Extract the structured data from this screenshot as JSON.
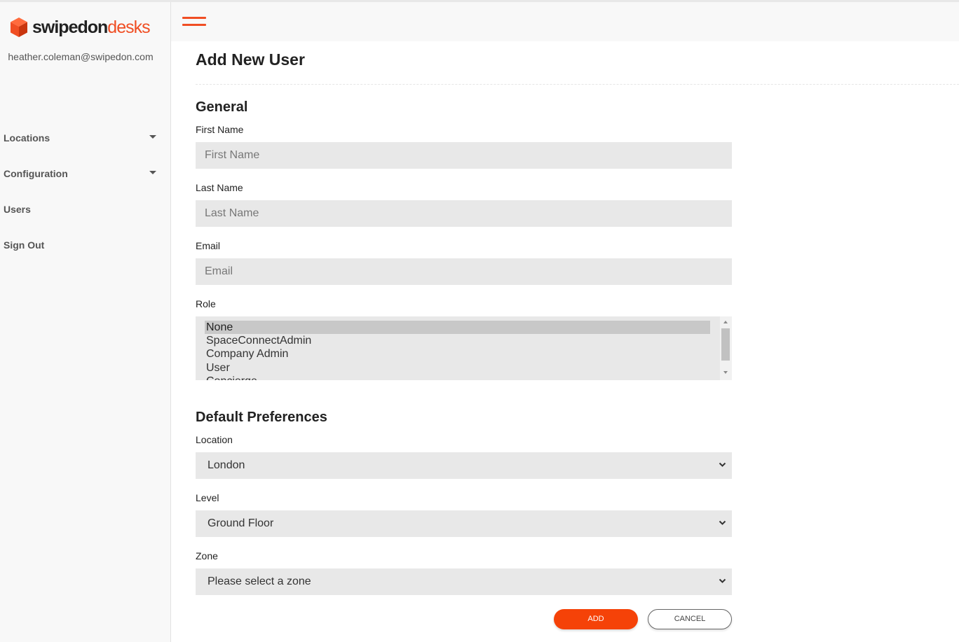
{
  "brand": {
    "name_part1": "swipedon",
    "name_part2": "desks",
    "accent_color": "#f04e23",
    "logo_icon": "cube-logo-icon"
  },
  "sidebar": {
    "user_email": "heather.coleman@swipedon.com",
    "items": [
      {
        "label": "Locations",
        "has_caret": true
      },
      {
        "label": "Configuration",
        "has_caret": true
      },
      {
        "label": "Users",
        "has_caret": false
      },
      {
        "label": "Sign Out",
        "has_caret": false
      }
    ]
  },
  "header": {
    "menu_icon": "hamburger-menu-icon"
  },
  "page": {
    "title": "Add New User"
  },
  "general": {
    "title": "General",
    "first_name": {
      "label": "First Name",
      "placeholder": "First Name",
      "value": ""
    },
    "last_name": {
      "label": "Last Name",
      "placeholder": "Last Name",
      "value": ""
    },
    "email": {
      "label": "Email",
      "placeholder": "Email",
      "value": ""
    },
    "role": {
      "label": "Role",
      "options": [
        "None",
        "SpaceConnectAdmin",
        "Company Admin",
        "User",
        "Concierge"
      ],
      "selected": "None"
    }
  },
  "preferences": {
    "title": "Default Preferences",
    "location": {
      "label": "Location",
      "value": "London"
    },
    "level": {
      "label": "Level",
      "value": "Ground Floor"
    },
    "zone": {
      "label": "Zone",
      "value": "Please select a zone"
    }
  },
  "actions": {
    "add_label": "ADD",
    "cancel_label": "CANCEL",
    "add_color": "#f54208"
  }
}
